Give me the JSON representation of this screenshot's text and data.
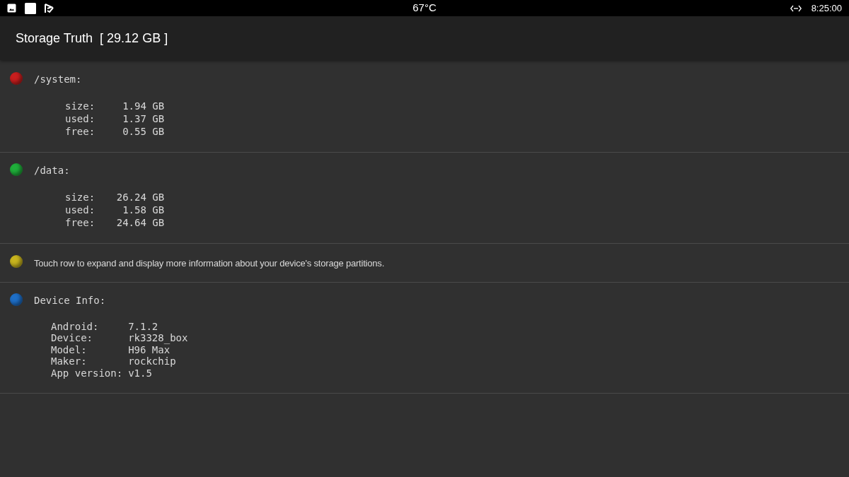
{
  "status_bar": {
    "temperature": "67°C",
    "time": "8:25:00"
  },
  "app_bar": {
    "title": "Storage Truth",
    "total": "[ 29.12 GB ]"
  },
  "rows": [
    {
      "kind": "partition",
      "color": "#c81e1e",
      "title": "/system:",
      "stats": [
        {
          "label": "size:",
          "value": "1.94 GB"
        },
        {
          "label": "used:",
          "value": "1.37 GB"
        },
        {
          "label": "free:",
          "value": "0.55 GB"
        }
      ]
    },
    {
      "kind": "partition",
      "color": "#1fae3a",
      "title": "/data:",
      "stats": [
        {
          "label": "size:",
          "value": "26.24 GB"
        },
        {
          "label": "used:",
          "value": "1.58 GB"
        },
        {
          "label": "free:",
          "value": "24.64 GB"
        }
      ]
    },
    {
      "kind": "hint",
      "color": "#c8b41e",
      "text": "Touch row to expand and display more information about your device's storage partitions."
    },
    {
      "kind": "info",
      "color": "#1e6fc8",
      "title": "Device Info:",
      "stats": [
        {
          "label": "Android:",
          "value": "7.1.2"
        },
        {
          "label": "Device:",
          "value": "rk3328_box"
        },
        {
          "label": "Model:",
          "value": "H96 Max"
        },
        {
          "label": "Maker:",
          "value": "rockchip"
        },
        {
          "label": "App version:",
          "value": "v1.5"
        }
      ]
    }
  ]
}
